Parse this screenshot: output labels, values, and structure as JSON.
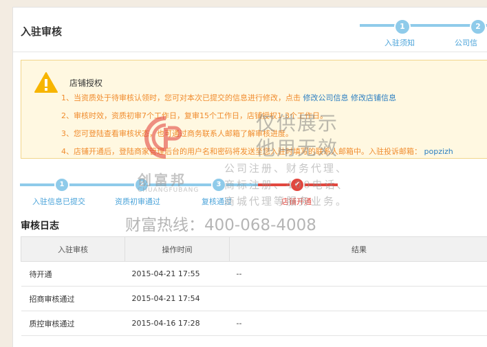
{
  "header": {
    "title": "入驻审核",
    "steps": [
      {
        "num": "1",
        "label": "入驻须知"
      },
      {
        "num": "2",
        "label": "公司信"
      }
    ]
  },
  "notice": {
    "title": "店铺授权",
    "lines": [
      {
        "text": "1、当资质处于待审核认领时，您可对本次已提交的信息进行修改，点击",
        "links": [
          "修改公司信息",
          "修改店铺信息"
        ]
      },
      {
        "text": "2、审核时效，资质初审7个工作日，复审15个工作日，店铺授权1-3个工作日。"
      },
      {
        "text": "3、您可登陆查看审核状态，也可通过商务联系人邮箱了解审核进度。"
      },
      {
        "text": "4、店铺开通后，登陆商家管理后台的用户名和密码将发送至您入驻时填写的联系人邮箱中。入驻投诉邮箱：",
        "link": "popzizh"
      }
    ]
  },
  "progress": {
    "steps": [
      {
        "num": "1",
        "label": "入驻信息已提交"
      },
      {
        "num": "2",
        "label": "资质初审通过"
      },
      {
        "num": "3",
        "label": "复核通过"
      },
      {
        "num": "✔",
        "label": "店铺开通"
      }
    ]
  },
  "log": {
    "title": "审核日志",
    "columns": [
      "入驻审核",
      "操作时间",
      "结果"
    ],
    "rows": [
      {
        "status": "待开通",
        "time": "2015-04-21 17:55",
        "result": "--"
      },
      {
        "status": "招商审核通过",
        "time": "2015-04-21 17:54",
        "result": ""
      },
      {
        "status": "质控审核通过",
        "time": "2015-04-16 17:28",
        "result": "--"
      }
    ]
  },
  "watermark": {
    "brand": "创富邦",
    "brand_en": "CHUANGFUBANG",
    "line1": "仅供展示",
    "line2": "他用无效",
    "line3": "公司注册、财务代理、",
    "line4": "商标注册、400电话、",
    "line5": "商城代理等服务业务。",
    "hotline": "财富热线：400-068-4008"
  },
  "colors": {
    "accent_blue": "#8fcbea",
    "link_blue": "#4aa3d9",
    "done_red": "#e2473f",
    "notice_orange": "#f08c2e"
  }
}
